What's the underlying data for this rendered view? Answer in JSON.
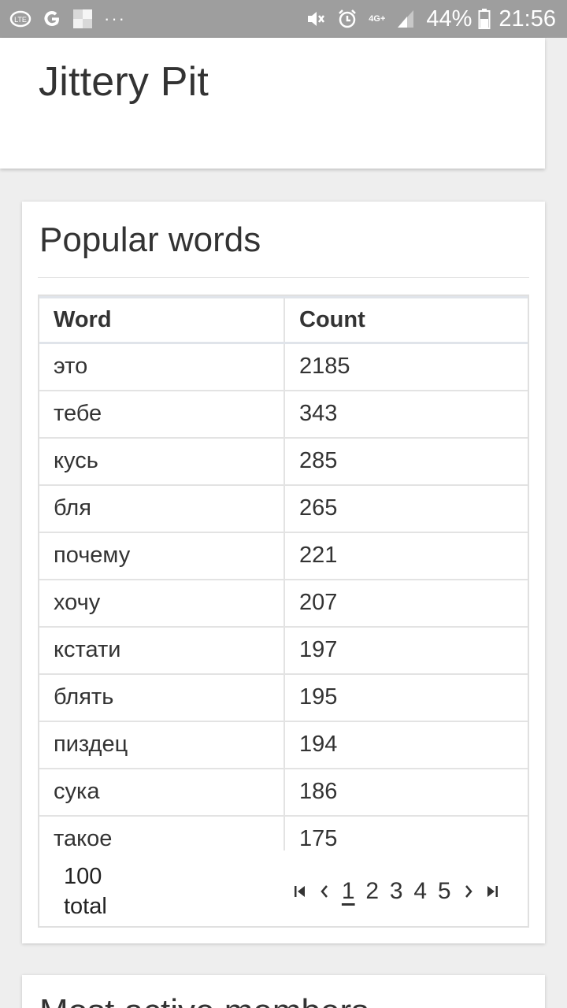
{
  "status_bar": {
    "network": "4G+",
    "battery_percent": "44%",
    "time": "21:56",
    "notification_icons": [
      "lte-icon",
      "google-icon",
      "gallery-icon",
      "more-dots-icon"
    ],
    "more": "···"
  },
  "header": {
    "title": "Jittery Pit"
  },
  "popular_words": {
    "title": "Popular words",
    "columns": [
      "Word",
      "Count"
    ],
    "rows": [
      [
        "это",
        "2185"
      ],
      [
        "тебе",
        "343"
      ],
      [
        "кусь",
        "285"
      ],
      [
        "бля",
        "265"
      ],
      [
        "почему",
        "221"
      ],
      [
        "хочу",
        "207"
      ],
      [
        "кстати",
        "197"
      ],
      [
        "блять",
        "195"
      ],
      [
        "пиздец",
        "194"
      ],
      [
        "сука",
        "186"
      ],
      [
        "такое",
        "175"
      ]
    ],
    "total_count": "100",
    "total_label": "total",
    "pagination": {
      "first": "⏮",
      "prev": "‹",
      "pages": [
        "1",
        "2",
        "3",
        "4",
        "5"
      ],
      "current": "1",
      "next": "›",
      "last": "⏭"
    }
  },
  "next_section": {
    "title": "Most active members"
  },
  "colors": {
    "status_bar": "#9e9e9e",
    "background": "#eeeeee",
    "card": "#ffffff",
    "text": "#333333"
  }
}
